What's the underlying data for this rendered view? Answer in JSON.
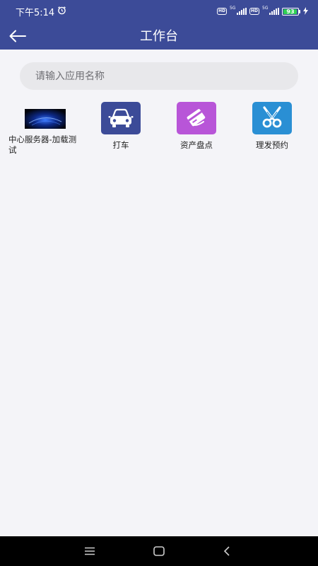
{
  "status_bar": {
    "time": "下午5:14",
    "hd1": "HD",
    "net1": "5G",
    "hd2": "HD",
    "net2": "5G",
    "battery": "93",
    "battery_level": 0.93
  },
  "header": {
    "title": "工作台"
  },
  "search": {
    "placeholder": "请输入应用名称",
    "value": ""
  },
  "apps": [
    {
      "label": "中心服务器-加载测试",
      "icon": "server-thumbnail-icon"
    },
    {
      "label": "打车",
      "icon": "car-icon",
      "color": "#3c4b98"
    },
    {
      "label": "资产盘点",
      "icon": "asset-card-icon",
      "color": "#b855d8"
    },
    {
      "label": "理发预约",
      "icon": "scissors-icon",
      "color": "#2a8fd4"
    }
  ],
  "colors": {
    "primary": "#3c4b98",
    "background": "#f4f4f8",
    "search_bg": "#e8e8eb",
    "battery_green": "#2fd153"
  }
}
